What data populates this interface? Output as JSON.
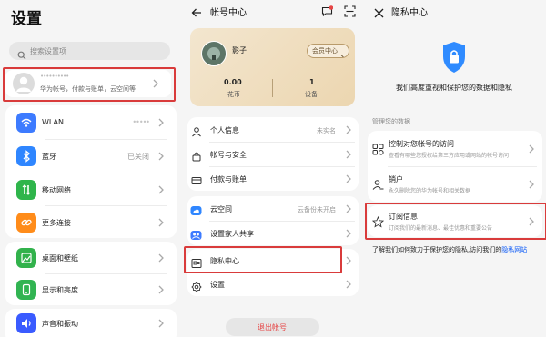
{
  "settings": {
    "title": "设置",
    "search_placeholder": "搜索设置项",
    "account_name": "••••••••••",
    "account_sub": "华为帐号，付款与账单，云空间等",
    "items": [
      {
        "label": "WLAN",
        "value": "•••••",
        "icon": "wifi-icon",
        "color": "#3d7bff"
      },
      {
        "label": "蓝牙",
        "value": "已关闭",
        "icon": "bluetooth-icon",
        "color": "#2f86ff"
      },
      {
        "label": "移动网络",
        "value": "",
        "icon": "mobile-network-icon",
        "color": "#2fb54b"
      },
      {
        "label": "更多连接",
        "value": "",
        "icon": "link-icon",
        "color": "#ff8c1a"
      },
      {
        "label": "桌面和壁纸",
        "value": "",
        "icon": "wallpaper-icon",
        "color": "#32b24c"
      },
      {
        "label": "显示和亮度",
        "value": "",
        "icon": "display-icon",
        "color": "#31b452"
      },
      {
        "label": "声音和振动",
        "value": "",
        "icon": "sound-icon",
        "color": "#3a5bff"
      }
    ]
  },
  "account_center": {
    "title": "帐号中心",
    "user_name": "影子",
    "member_button": "会员中心",
    "stats": [
      {
        "value": "0.00",
        "label": "花币"
      },
      {
        "value": "1",
        "label": "设备"
      }
    ],
    "menu": [
      {
        "label": "个人信息",
        "value": "未实名",
        "icon": "person-icon"
      },
      {
        "label": "帐号与安全",
        "value": "",
        "icon": "lock-icon"
      },
      {
        "label": "付款与账单",
        "value": "",
        "icon": "card-icon"
      }
    ],
    "menu2": [
      {
        "label": "云空间",
        "value": "云备份未开启",
        "icon": "cloud-icon"
      },
      {
        "label": "设置家人共享",
        "value": "",
        "icon": "family-icon"
      }
    ],
    "menu3": [
      {
        "label": "隐私中心",
        "icon": "privacy-icon"
      },
      {
        "label": "设置",
        "icon": "gear-icon"
      }
    ],
    "logout": "退出帐号"
  },
  "privacy_center": {
    "title": "隐私中心",
    "headline": "我们高度重视和保护您的数据和隐私",
    "section_label": "管理您的数据",
    "items": [
      {
        "label": "控制对您帐号的访问",
        "desc": "查看有哪些您授权给第三方应用或网站的帐号访问",
        "icon": "control-icon"
      },
      {
        "label": "销户",
        "desc": "永久删除您的华为帐号和相关数据",
        "icon": "user-remove-icon"
      },
      {
        "label": "订阅信息",
        "desc": "订阅我们的最新消息、最佳优惠和重要公告",
        "icon": "star-icon"
      }
    ],
    "footer_text": "了解我们如何致力于保护您的隐私,访问我们的",
    "footer_link": "隐私网站"
  },
  "colors": {
    "accent": "#0a59f7",
    "highlight": "#d93b3b",
    "logout_red": "#e64545"
  }
}
